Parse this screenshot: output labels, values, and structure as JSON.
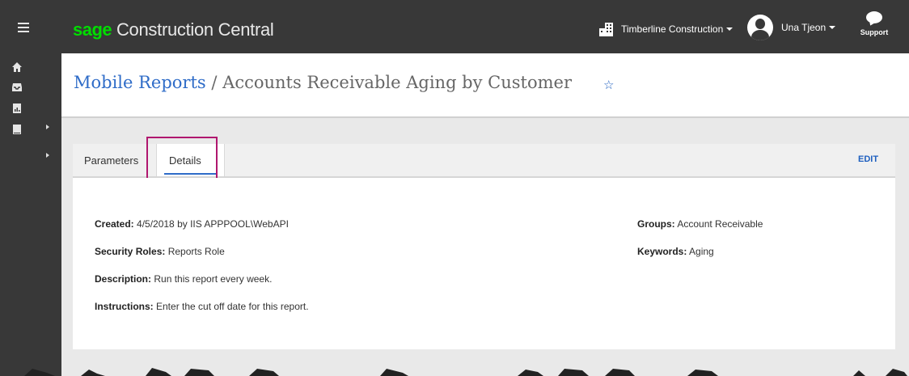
{
  "topbar": {
    "brand_sage": "sage",
    "brand_rest": " Construction Central",
    "company": "Timberline Construction",
    "user": "Una Tjeon",
    "support": "Support"
  },
  "header": {
    "breadcrumb_link": "Mobile Reports",
    "separator": " / ",
    "page_title": "Accounts Receivable Aging by Customer",
    "star_glyph": "☆"
  },
  "tabs": [
    {
      "label": "Parameters",
      "active": false
    },
    {
      "label": "Details",
      "active": true
    }
  ],
  "edit_label": "EDIT",
  "details": {
    "created_label": "Created:",
    "created_value": " 4/5/2018 by IIS APPPOOL\\WebAPI",
    "security_label": "Security Roles:",
    "security_value": " Reports Role",
    "description_label": "Description:",
    "description_value": " Run this report every week.",
    "instructions_label": "Instructions:",
    "instructions_value": " Enter the cut off date for this report.",
    "groups_label": "Groups:",
    "groups_value": " Account Receivable",
    "keywords_label": "Keywords:",
    "keywords_value": " Aging"
  },
  "colors": {
    "topbar": "#383838",
    "brand_accent": "#00dc00",
    "link": "#2f6cc8",
    "highlight": "#b0176f"
  }
}
